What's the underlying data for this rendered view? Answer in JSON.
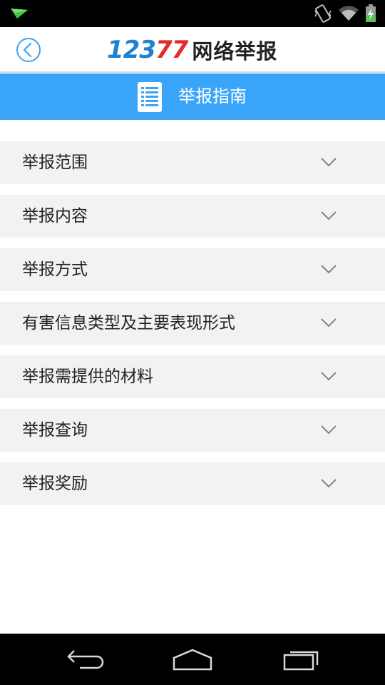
{
  "status_bar": {
    "icons": [
      "notification-icon",
      "vibrate-icon",
      "wifi-icon",
      "battery-charging-icon"
    ]
  },
  "header": {
    "logo_number_digits_blue": "123",
    "logo_number_digits_red": "77",
    "logo_text": "网络举报"
  },
  "title_bar": {
    "title": "举报指南"
  },
  "list": {
    "items": [
      {
        "label": "举报范围"
      },
      {
        "label": "举报内容"
      },
      {
        "label": "举报方式"
      },
      {
        "label": "有害信息类型及主要表现形式"
      },
      {
        "label": "举报需提供的材料"
      },
      {
        "label": "举报查询"
      },
      {
        "label": "举报奖励"
      }
    ]
  },
  "colors": {
    "accent": "#3aa4f8",
    "logo_blue": "#1f7fd3",
    "logo_red": "#e62a2a",
    "item_bg": "#f2f2f2"
  }
}
